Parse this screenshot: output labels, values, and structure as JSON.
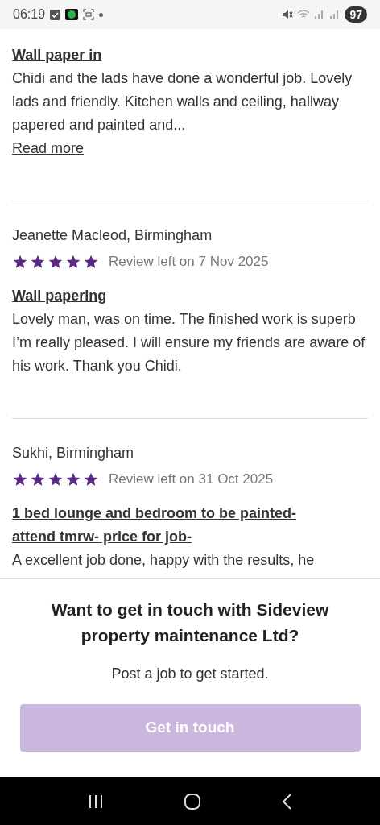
{
  "status_bar": {
    "time": "06:19",
    "battery": "97"
  },
  "reviews": [
    {
      "title": "Wall paper in",
      "body": "Chidi and the lads have done a wonderful job. Lovely lads and friendly. Kitchen walls and ceiling, hallway papered and painted and...",
      "read_more": "Read more"
    },
    {
      "author": "Jeanette Macleod, Birmingham",
      "stars": 5,
      "date": "Review left on 7 Nov 2025",
      "title": "Wall papering",
      "body": "Lovely man, was on time. The finished work is superb I’m really pleased. I will ensure my friends are aware of his work. Thank you Chidi."
    },
    {
      "author": "Sukhi, Birmingham",
      "stars": 5,
      "date": "Review left on 31 Oct 2025",
      "title": "1 bed lounge and bedroom to be painted- attend tmrw- price for job-",
      "body": "A excellent job done, happy with the results, he"
    }
  ],
  "contact": {
    "heading": "Want to get in touch with Sideview property maintenance Ltd?",
    "subtext": "Post a job to get started.",
    "button": {
      "label": "Get in touch",
      "disabled": true
    }
  }
}
